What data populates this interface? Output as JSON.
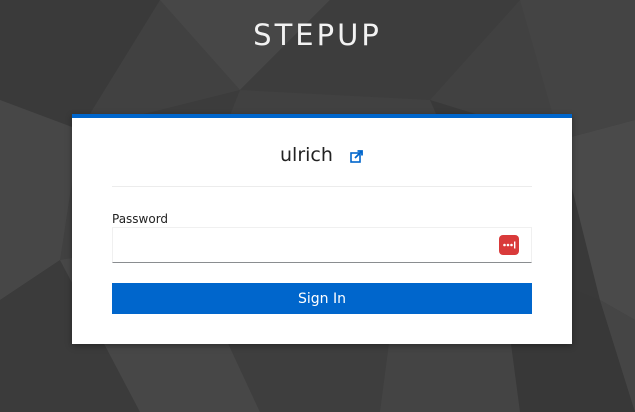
{
  "brand": {
    "title": "STEPUP"
  },
  "login": {
    "username": "ulrich",
    "password_label": "Password",
    "password_value": "",
    "sign_in_label": "Sign In"
  },
  "icons": {
    "restart": "restart-login-icon",
    "password_manager": "password-manager-icon"
  },
  "colors": {
    "accent": "#0066cc",
    "background": "#3f3f3f",
    "password_manager": "#d93a3a"
  }
}
